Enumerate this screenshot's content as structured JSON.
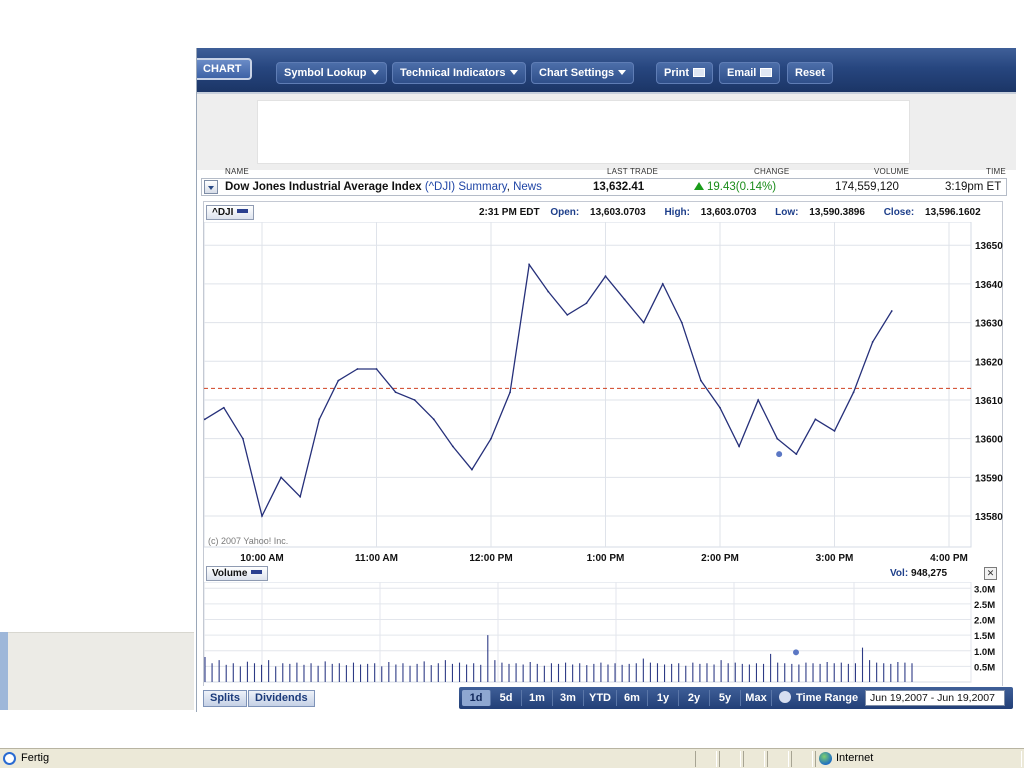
{
  "toolbar": {
    "chart_tab": "CHART",
    "symbol_lookup": "Symbol Lookup",
    "technical_indicators": "Technical Indicators",
    "chart_settings": "Chart Settings",
    "print": "Print",
    "email": "Email",
    "reset": "Reset"
  },
  "quote_header": {
    "name": "NAME",
    "last_trade": "LAST TRADE",
    "change": "CHANGE",
    "volume": "VOLUME",
    "time": "TIME"
  },
  "quote": {
    "name": "Dow Jones Industrial Average Index",
    "symbol": "(^DJI)",
    "summary_link": "Summary",
    "separator": ",",
    "news_link": "News",
    "last_trade": "13,632.41",
    "change": "19.43(0.14%)",
    "change_color": "#1a8c1a",
    "volume": "174,559,120",
    "time": "3:19pm ET"
  },
  "chart": {
    "symbol_button": "^DJI",
    "cursor_time": "2:31 PM EDT",
    "open_label": "Open:",
    "open": "13,603.0703",
    "high_label": "High:",
    "high": "13,603.0703",
    "low_label": "Low:",
    "low": "13,590.3896",
    "close_label": "Close:",
    "close": "13,596.1602",
    "copyright": "(c) 2007 Yahoo! Inc.",
    "volume_button": "Volume",
    "vol_label": "Vol:",
    "vol_value": "948,275",
    "close_icon": "x-icon",
    "line_color": "#26307a",
    "prev_close_color": "#d04020"
  },
  "chart_data": [
    {
      "type": "line",
      "title": "",
      "series": [
        {
          "name": "^DJI",
          "x": [
            "09:30",
            "09:40",
            "09:50",
            "10:00",
            "10:10",
            "10:20",
            "10:30",
            "10:40",
            "10:50",
            "11:00",
            "11:10",
            "11:20",
            "11:30",
            "11:40",
            "11:50",
            "12:00",
            "12:10",
            "12:20",
            "12:30",
            "12:40",
            "12:50",
            "13:00",
            "13:10",
            "13:20",
            "13:30",
            "13:40",
            "13:50",
            "14:00",
            "14:10",
            "14:20",
            "14:30",
            "14:40",
            "14:50",
            "15:00",
            "15:10",
            "15:20",
            "15:30"
          ],
          "values": [
            13605,
            13608,
            13600,
            13580,
            13590,
            13585,
            13605,
            13615,
            13618,
            13618,
            13612,
            13610,
            13605,
            13598,
            13592,
            13600,
            13612,
            13645,
            13638,
            13632,
            13635,
            13642,
            13636,
            13630,
            13640,
            13630,
            13615,
            13608,
            13598,
            13610,
            13600,
            13596,
            13605,
            13602,
            13612,
            13625,
            13633
          ]
        }
      ],
      "x_ticks": [
        "10:00 AM",
        "11:00 AM",
        "12:00 PM",
        "1:00 PM",
        "2:00 PM",
        "3:00 PM",
        "4:00 PM"
      ],
      "y_ticks": [
        13580,
        13590,
        13600,
        13610,
        13620,
        13630,
        13640,
        13650
      ],
      "ylim": [
        13572,
        13656
      ],
      "previous_close": 13613,
      "grid": true
    },
    {
      "type": "bar",
      "title": "",
      "y_ticks": [
        "3.0M",
        "2.5M",
        "2.0M",
        "1.5M",
        "1.0M",
        "0.5M"
      ],
      "ylim": [
        0,
        3.2
      ],
      "unit": "M",
      "values": [
        0.8,
        0.6,
        0.7,
        0.55,
        0.6,
        0.5,
        0.65,
        0.6,
        0.55,
        0.7,
        0.5,
        0.6,
        0.58,
        0.62,
        0.55,
        0.6,
        0.52,
        0.66,
        0.58,
        0.6,
        0.54,
        0.62,
        0.56,
        0.58,
        0.6,
        0.5,
        0.64,
        0.56,
        0.6,
        0.52,
        0.58,
        0.66,
        0.54,
        0.6,
        0.7,
        0.58,
        0.62,
        0.56,
        0.6,
        0.55,
        1.5,
        0.7,
        0.62,
        0.58,
        0.6,
        0.56,
        0.64,
        0.58,
        0.52,
        0.6,
        0.58,
        0.62,
        0.56,
        0.6,
        0.54,
        0.58,
        0.62,
        0.56,
        0.6,
        0.55,
        0.58,
        0.6,
        0.75,
        0.62,
        0.6,
        0.56,
        0.58,
        0.6,
        0.52,
        0.62,
        0.58,
        0.6,
        0.56,
        0.7,
        0.6,
        0.62,
        0.58,
        0.56,
        0.6,
        0.58,
        0.9,
        0.62,
        0.6,
        0.58,
        0.56,
        0.62,
        0.6,
        0.58,
        0.64,
        0.6,
        0.62,
        0.58,
        0.6,
        1.1,
        0.7,
        0.62,
        0.6,
        0.58,
        0.64,
        0.62,
        0.6
      ]
    }
  ],
  "bottom_bar": {
    "splits": "Splits",
    "dividends": "Dividends",
    "ranges": [
      "1d",
      "5d",
      "1m",
      "3m",
      "YTD",
      "6m",
      "1y",
      "2y",
      "5y",
      "Max"
    ],
    "active_range": "1d",
    "time_range": "Time Range",
    "date_range": "Jun 19,2007 - Jun 19,2007"
  },
  "status_bar": {
    "status": "Fertig",
    "zone": "Internet"
  }
}
